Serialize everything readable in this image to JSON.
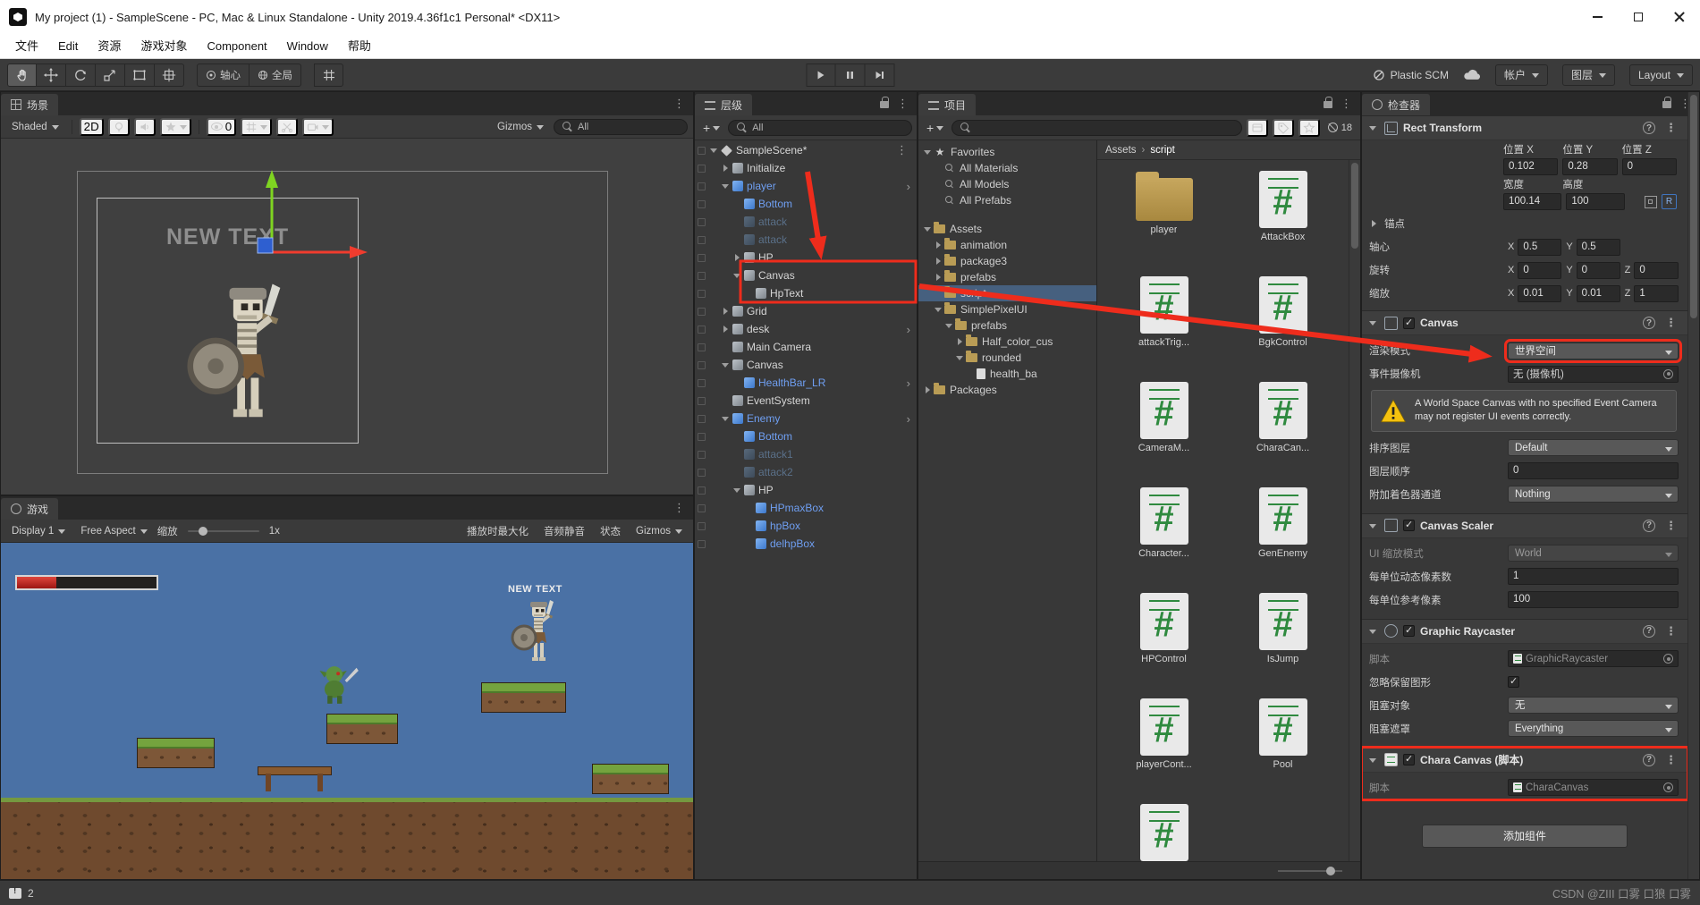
{
  "title_bar": {
    "title": "My project (1) - SampleScene - PC, Mac & Linux Standalone - Unity 2019.4.36f1c1 Personal* <DX11>"
  },
  "menu_bar": {
    "items": [
      "文件",
      "Edit",
      "资源",
      "游戏对象",
      "Component",
      "Window",
      "帮助"
    ]
  },
  "toolbar": {
    "pivot": "轴心",
    "global": "全局",
    "plastic_scm": "Plastic SCM",
    "account": "帐户",
    "layers": "图层",
    "layout": "Layout"
  },
  "scene": {
    "tab": "场景",
    "shaded": "Shaded",
    "two_d": "2D",
    "hidden_count": "0",
    "gizmos": "Gizmos",
    "search_value": "All",
    "overlay_text": "NEW TEXT"
  },
  "game": {
    "tab": "游戏",
    "display": "Display 1",
    "aspect": "Free Aspect",
    "zoom_label": "缩放",
    "zoom_value": "1x",
    "maximize_on_play": "播放时最大化",
    "mute_audio": "音频静音",
    "stats": "状态",
    "gizmos": "Gizmos",
    "overlay_text": "NEW TEXT",
    "health_percent": 28
  },
  "hierarchy": {
    "tab": "层级",
    "add_button": "+",
    "search_value": "All",
    "rows": [
      {
        "label": "SampleScene*",
        "depth": 0,
        "exp": "open",
        "color": "white",
        "icon": "scene",
        "kebab": true
      },
      {
        "label": "Initialize",
        "depth": 1,
        "exp": "closed",
        "color": "white",
        "icon": "cube"
      },
      {
        "label": "player",
        "depth": 1,
        "exp": "open",
        "color": "blue",
        "icon": "prefab",
        "arrow": true
      },
      {
        "label": "Bottom",
        "depth": 2,
        "exp": "none",
        "color": "blue",
        "icon": "prefab"
      },
      {
        "label": "attack",
        "depth": 2,
        "exp": "none",
        "color": "faded",
        "icon": "faded"
      },
      {
        "label": "attack",
        "depth": 2,
        "exp": "none",
        "color": "faded",
        "icon": "faded"
      },
      {
        "label": "HP",
        "depth": 2,
        "exp": "closed",
        "color": "white",
        "icon": "cube"
      },
      {
        "label": "Canvas",
        "depth": 2,
        "exp": "open",
        "color": "white",
        "icon": "cube"
      },
      {
        "label": "HpText",
        "depth": 3,
        "exp": "none",
        "color": "white",
        "icon": "cube"
      },
      {
        "label": "Grid",
        "depth": 1,
        "exp": "closed",
        "color": "white",
        "icon": "cube"
      },
      {
        "label": "desk",
        "depth": 1,
        "exp": "closed",
        "color": "white",
        "icon": "cube",
        "arrow": true
      },
      {
        "label": "Main Camera",
        "depth": 1,
        "exp": "none",
        "color": "white",
        "icon": "cube"
      },
      {
        "label": "Canvas",
        "depth": 1,
        "exp": "open",
        "color": "white",
        "icon": "cube"
      },
      {
        "label": "HealthBar_LR",
        "depth": 2,
        "exp": "none",
        "color": "blue",
        "icon": "prefab",
        "arrow": true
      },
      {
        "label": "EventSystem",
        "depth": 1,
        "exp": "none",
        "color": "white",
        "icon": "cube"
      },
      {
        "label": "Enemy",
        "depth": 1,
        "exp": "open",
        "color": "blue",
        "icon": "prefab",
        "arrow": true
      },
      {
        "label": "Bottom",
        "depth": 2,
        "exp": "none",
        "color": "blue",
        "icon": "prefab"
      },
      {
        "label": "attack1",
        "depth": 2,
        "exp": "none",
        "color": "faded",
        "icon": "faded"
      },
      {
        "label": "attack2",
        "depth": 2,
        "exp": "none",
        "color": "faded",
        "icon": "faded"
      },
      {
        "label": "HP",
        "depth": 2,
        "exp": "open",
        "color": "white",
        "icon": "cube"
      },
      {
        "label": "HPmaxBox",
        "depth": 3,
        "exp": "none",
        "color": "blue",
        "icon": "prefab"
      },
      {
        "label": "hpBox",
        "depth": 3,
        "exp": "none",
        "color": "blue",
        "icon": "prefab"
      },
      {
        "label": "delhpBox",
        "depth": 3,
        "exp": "none",
        "color": "blue",
        "icon": "prefab"
      }
    ]
  },
  "project": {
    "tab": "项目",
    "add_button": "+",
    "hidden_badge": "18",
    "breadcrumb": [
      "Assets",
      "script"
    ],
    "tree": [
      {
        "label": "Favorites",
        "depth": 0,
        "exp": "open",
        "icon": "star"
      },
      {
        "label": "All Materials",
        "depth": 1,
        "exp": "none",
        "icon": "search"
      },
      {
        "label": "All Models",
        "depth": 1,
        "exp": "none",
        "icon": "search"
      },
      {
        "label": "All Prefabs",
        "depth": 1,
        "exp": "none",
        "icon": "search"
      },
      {
        "label": "",
        "depth": 0,
        "exp": "none",
        "icon": "spacer"
      },
      {
        "label": "Assets",
        "depth": 0,
        "exp": "open",
        "icon": "folder"
      },
      {
        "label": "animation",
        "depth": 1,
        "exp": "closed",
        "icon": "folder"
      },
      {
        "label": "package3",
        "depth": 1,
        "exp": "closed",
        "icon": "folder"
      },
      {
        "label": "prefabs",
        "depth": 1,
        "exp": "closed",
        "icon": "folder"
      },
      {
        "label": "script",
        "depth": 1,
        "exp": "none",
        "icon": "folder",
        "selected": true
      },
      {
        "label": "SimplePixelUI",
        "depth": 1,
        "exp": "open",
        "icon": "folder"
      },
      {
        "label": "prefabs",
        "depth": 2,
        "exp": "open",
        "icon": "folder"
      },
      {
        "label": "Half_color_cus",
        "depth": 3,
        "exp": "closed",
        "icon": "folder"
      },
      {
        "label": "rounded",
        "depth": 3,
        "exp": "open",
        "icon": "folder"
      },
      {
        "label": "health_ba",
        "depth": 4,
        "exp": "none",
        "icon": "file"
      },
      {
        "label": "Packages",
        "depth": 0,
        "exp": "closed",
        "icon": "folder"
      }
    ],
    "files": [
      {
        "name": "player",
        "icon": "folder"
      },
      {
        "name": "AttackBox",
        "icon": "script"
      },
      {
        "name": "attackTrig...",
        "icon": "script"
      },
      {
        "name": "BgkControl",
        "icon": "script"
      },
      {
        "name": "CameraM...",
        "icon": "script"
      },
      {
        "name": "CharaCan...",
        "icon": "script"
      },
      {
        "name": "Character...",
        "icon": "script"
      },
      {
        "name": "GenEnemy",
        "icon": "script"
      },
      {
        "name": "HPControl",
        "icon": "script"
      },
      {
        "name": "IsJump",
        "icon": "script"
      },
      {
        "name": "playerCont...",
        "icon": "script"
      },
      {
        "name": "Pool",
        "icon": "script"
      },
      {
        "name": "",
        "icon": "script"
      }
    ]
  },
  "inspector": {
    "tab": "检查器",
    "rect_transform": {
      "title": "Rect Transform",
      "pos_x_label": "位置 X",
      "pos_y_label": "位置 Y",
      "pos_z_label": "位置 Z",
      "pos_x": "0.102",
      "pos_y": "0.28",
      "pos_z": "0",
      "width_label": "宽度",
      "height_label": "高度",
      "width": "100.14",
      "height": "100",
      "r_badge": "R",
      "anchors_label": "锚点",
      "pivot_label": "轴心",
      "rotation_label": "旋转",
      "scale_label": "缩放",
      "x": "X",
      "y": "Y",
      "z": "Z",
      "pivot_x": "0.5",
      "pivot_y": "0.5",
      "rot_x": "0",
      "rot_y": "0",
      "rot_z": "0",
      "scale_x": "0.01",
      "scale_y": "0.01",
      "scale_z": "1"
    },
    "canvas": {
      "title": "Canvas",
      "render_mode_label": "渲染模式",
      "render_mode": "世界空间",
      "event_camera_label": "事件摄像机",
      "event_camera": "无 (摄像机)",
      "warning": "A World Space Canvas with no specified Event Camera may not register UI events correctly.",
      "sorting_layer_label": "排序图层",
      "sorting_layer": "Default",
      "order_label": "图层顺序",
      "order_value": "0",
      "shader_channels_label": "附加着色器通道",
      "shader_channels": "Nothing"
    },
    "canvas_scaler": {
      "title": "Canvas Scaler",
      "scale_mode_label": "UI 缩放模式",
      "scale_mode": "World",
      "dynamic_ppu_label": "每单位动态像素数",
      "dynamic_ppu": "1",
      "reference_ppu_label": "每单位参考像素",
      "reference_ppu": "100"
    },
    "graphic_raycaster": {
      "title": "Graphic Raycaster",
      "script_label": "脚本",
      "script_value": "GraphicRaycaster",
      "ignore_reversed_label": "忽略保留图形",
      "blocking_objects_label": "阻塞对象",
      "blocking_objects": "无",
      "blocking_mask_label": "阻塞遮罩",
      "blocking_mask": "Everything"
    },
    "chara_canvas": {
      "title": "Chara Canvas (脚本)",
      "script_label": "脚本",
      "script_value": "CharaCanvas"
    },
    "add_component": "添加组件"
  },
  "status_bar": {
    "console_count": "2",
    "watermark": "CSDN @ZIII 口雾 口狼 口雾"
  }
}
